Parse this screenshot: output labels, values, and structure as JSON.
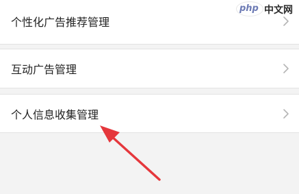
{
  "settings": {
    "items": [
      {
        "label": "个性化广告推荐管理"
      },
      {
        "label": "互动广告管理"
      },
      {
        "label": "个人信息收集管理"
      }
    ]
  },
  "watermark": {
    "brand": "php",
    "site": "中文网"
  },
  "annotation": {
    "arrow_color": "#e5373c",
    "points_to": "个人信息收集管理"
  }
}
